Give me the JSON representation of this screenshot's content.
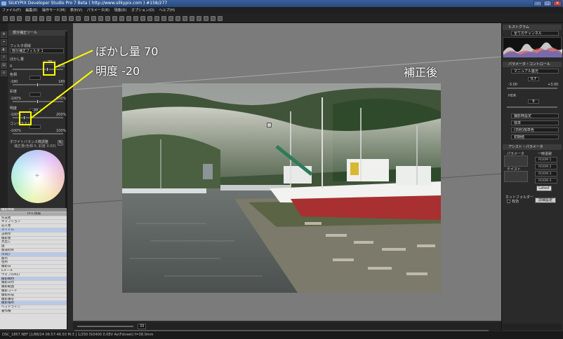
{
  "window": {
    "title": "SILKYPIX Developer Studio Pro 7 Beta ( http://www.silkypix.com )   #158/277"
  },
  "menu": [
    "ファイル(F)",
    "編集(E)",
    "操作モード(M)",
    "表示(V)",
    "パラメータ(R)",
    "現像(D)",
    "オプション(O)",
    "ヘルプ(H)"
  ],
  "left_panel": {
    "title": "部分補正ツール",
    "filter_label": "フィルタ領域",
    "filter_value": "部分補正フィルタ 1",
    "blur_label": "ぼかし量",
    "blur_min": "0",
    "blur_max": "100",
    "blur_value": "70",
    "color_label": "色相",
    "color_min": "-180",
    "color_max": "180",
    "sat_label": "彩度",
    "sat_min": "-100%",
    "sat_max": "100%",
    "bright_label": "明度",
    "bright_min": "-100%",
    "bright_max": "200%",
    "bright_value": "-20",
    "contrast_label": "コントラスト",
    "contrast_min": "-100%",
    "contrast_max": "100%",
    "wb_label": "ホワイトバランス微調整",
    "wb_detail": "補正量(色相 0, 彩度 0.00)",
    "meta_header": "撮影情報",
    "meta_subheader": "IPTC情報",
    "meta_rows": [
      "作成者",
      "キャプション",
      "記入者",
      "タイトル",
      "説明文",
      "撮影者",
      "見出し",
      "国",
      "都道府県",
      "市(町)",
      "都市",
      "住所",
      "撮影日",
      "Eメール",
      "ウェブ(URL)",
      "撮影機材",
      "撮影日付",
      "撮影範囲",
      "撮影コード",
      "撮影形成",
      "撮影番号",
      "撮影場所",
      "ヘッドライン",
      "著作権"
    ]
  },
  "annotations": {
    "blur": "ぼかし量 70",
    "brightness": "明度 -20",
    "after": "補正後"
  },
  "right_panel": {
    "histogram_title": "ヒストグラム",
    "histogram_channel": "全てのチャンネル",
    "param_title": "パラメータ・コントロール",
    "param_mode": "マニュアル露光",
    "exposure_min": "-3.00",
    "exposure_max": "+3.00",
    "exposure_value": "0.7",
    "hdr_label": "HDR",
    "hdr_value": "0",
    "items": [
      "撮影時設定",
      "標準",
      "(日照)標準色",
      "初期値"
    ],
    "assist_title": "アシスト・パラメータ",
    "param_group": "パラメータ",
    "taste_group": "テイスト",
    "rooms_title": "一時退避",
    "rooms": [
      "ROOM 1",
      "ROOM 2",
      "ROOM 3",
      "ROOM 4"
    ],
    "latest": "Latest",
    "hotfolder_title": "ホットフォルダー",
    "hotfolder_enable": "有効",
    "hotfolder_detail": "詳細設定"
  },
  "nav": {
    "zoom": "33"
  },
  "status": "DSC_1857.NEF  [1/88/24 06:57:48.50 M:3 ]  1/250 ISO400  0.0EV  Av(Fstreet) f=38.0mm",
  "colors": {
    "annotation": "#ffff00",
    "title_bar": "#2f5590"
  }
}
